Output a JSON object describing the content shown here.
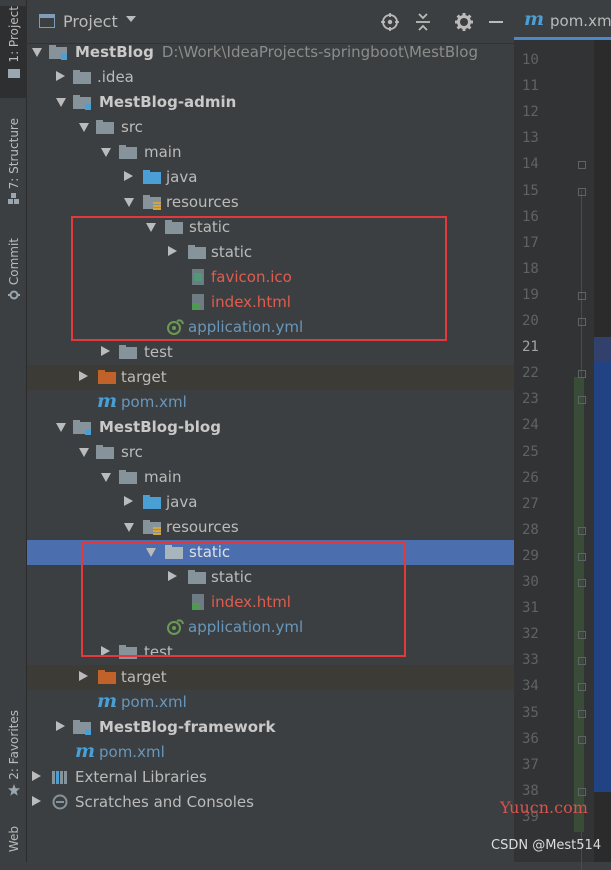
{
  "sidebar": {
    "project_tab": "1: Project",
    "structure_tab": "7: Structure",
    "commit_tab": "Commit",
    "favorites_tab": "2: Favorites",
    "web_tab": "Web"
  },
  "panel": {
    "title": "Project"
  },
  "tree": {
    "root_name": "MestBlog",
    "root_path": "D:\\Work\\IdeaProjects-springboot\\MestBlog",
    "idea": ".idea",
    "admin": "MestBlog-admin",
    "admin_src": "src",
    "admin_main": "main",
    "admin_java": "java",
    "admin_resources": "resources",
    "admin_static": "static",
    "admin_static_inner": "static",
    "admin_favicon": "favicon.ico",
    "admin_index": "index.html",
    "admin_app_yml": "application.yml",
    "admin_test": "test",
    "admin_target": "target",
    "admin_pom": "pom.xml",
    "blog": "MestBlog-blog",
    "blog_src": "src",
    "blog_main": "main",
    "blog_java": "java",
    "blog_resources": "resources",
    "blog_static": "static",
    "blog_static_inner": "static",
    "blog_index": "index.html",
    "blog_app_yml": "application.yml",
    "blog_test": "test",
    "blog_target": "target",
    "blog_pom": "pom.xml",
    "framework": "MestBlog-framework",
    "root_pom": "pom.xml",
    "ext_libs": "External Libraries",
    "scratches": "Scratches and Consoles"
  },
  "editor": {
    "tab_label": "pom.xm",
    "line_numbers": [
      "10",
      "11",
      "12",
      "13",
      "14",
      "15",
      "16",
      "17",
      "18",
      "19",
      "20",
      "21",
      "22",
      "23",
      "24",
      "25",
      "26",
      "27",
      "28",
      "29",
      "30",
      "31",
      "32",
      "33",
      "34",
      "35",
      "36",
      "37",
      "38",
      "39"
    ],
    "current_line": "21"
  },
  "watermark": {
    "site": "Yuucn.com",
    "credit": "CSDN @Mest514"
  },
  "colors": {
    "selection": "#4b6eaf",
    "highlight_box": "#e4393c",
    "folder": "#87939a",
    "target_folder": "#c0622a",
    "maven_blue": "#4a9fd5"
  }
}
